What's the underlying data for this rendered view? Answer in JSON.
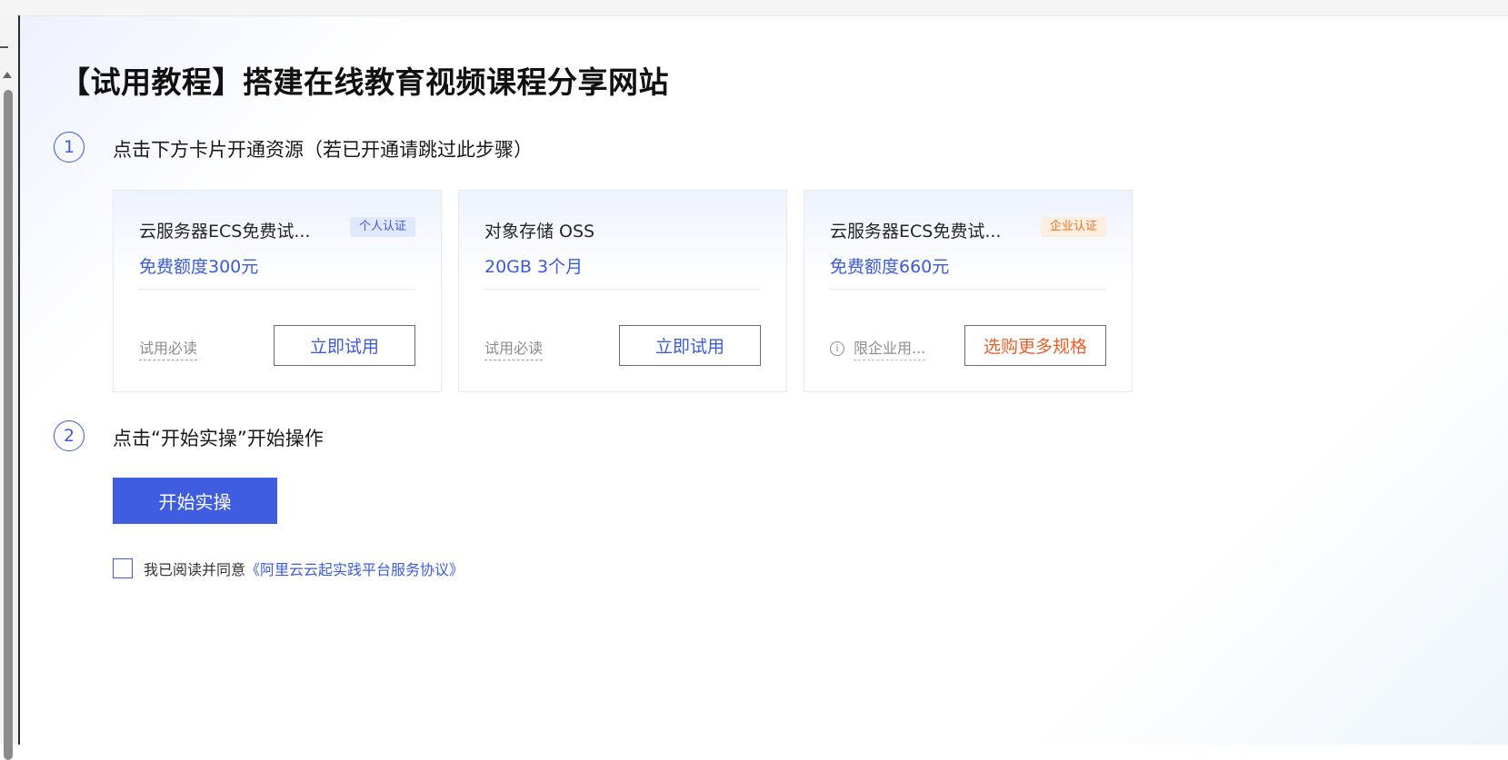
{
  "title": "【试用教程】搭建在线教育视频课程分享网站",
  "steps": [
    {
      "number": "1",
      "text": "点击下方卡片开通资源（若已开通请跳过此步骤）"
    },
    {
      "number": "2",
      "text": "点击“开始实操”开始操作"
    }
  ],
  "cards": [
    {
      "name": "云服务器ECS免费试...",
      "badge": "个人认证",
      "quota": "免费额度300元",
      "note": "试用必读",
      "button": "立即试用"
    },
    {
      "name": "对象存储 OSS",
      "quota": "20GB 3个月",
      "note": "试用必读",
      "button": "立即试用"
    },
    {
      "name": "云服务器ECS免费试...",
      "badge": "企业认证",
      "quota": "免费额度660元",
      "note": "限企业用...",
      "button": "选购更多规格"
    }
  ],
  "start_button": "开始实操",
  "agreement": {
    "text": "我已阅读并同意",
    "link": "《阿里云云起实践平台服务协议》",
    "checked": false
  },
  "colors": {
    "accent_blue": "#3b5bdb",
    "primary_button": "#3f5de0",
    "enterprise_orange": "#e8622c"
  },
  "icons": {
    "info": "i"
  }
}
